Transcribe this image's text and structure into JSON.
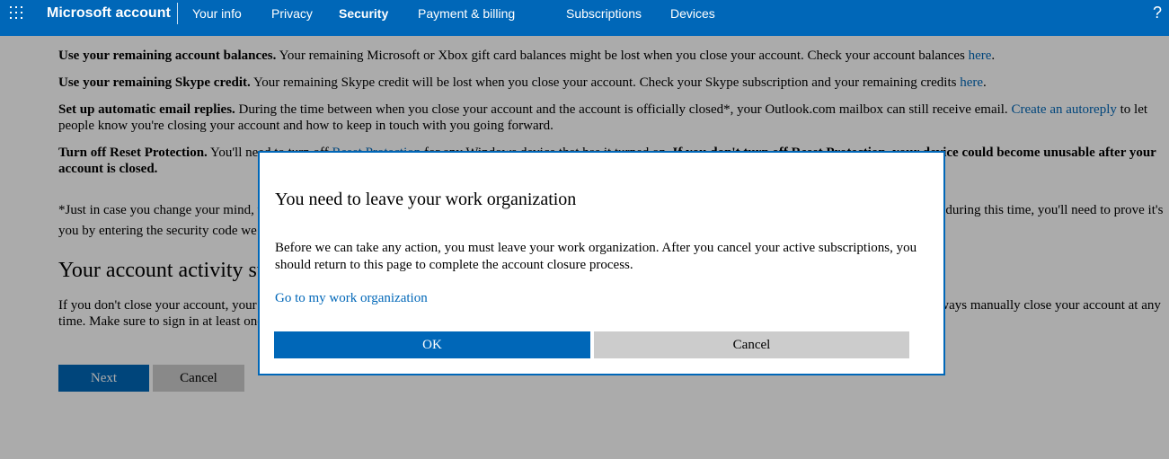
{
  "topbar": {
    "brand": "Microsoft account",
    "nav": [
      "Your info",
      "Privacy",
      "Security",
      "Payment & billing",
      "Subscriptions",
      "Devices"
    ],
    "active_tab": "Security",
    "help": "?"
  },
  "content": {
    "p1": {
      "bold": "Use your remaining account balances.",
      "text": " Your remaining Microsoft or Xbox gift card balances might be lost when you close your account. Check your account balances ",
      "link": "here",
      "end": "."
    },
    "p2": {
      "bold": "Use your remaining Skype credit.",
      "text": " Your remaining Skype credit will be lost when you close your account. Check your Skype subscription and your remaining credits ",
      "link": "here",
      "end": "."
    },
    "p3": {
      "bold": "Set up automatic email replies.",
      "text": " During the time between when you close your account and the account is officially closed*, your Outlook.com mailbox can still receive email. ",
      "link": "Create an autoreply",
      "end": " to let people know you're closing your account and how to keep in touch with you going forward."
    },
    "p4": {
      "bold": "Turn off Reset Protection.",
      "text": " You'll need to turn off ",
      "link": "Reset Protection",
      "mid": " for any Windows device that has it turned on. ",
      "bold2": "If you don't turn off Reset Protection, your device could become unusable after your account is closed."
    },
    "p5": "*Just in case you change your mind, we'll wait 60 days before permanently closing your account. During this time, your account still exists. To reopen your account during this time, you'll need to prove it's you by entering the security code we send.",
    "heading": "Your account activity status",
    "p6": "If you don't close your account, your account might still be closed if there is no activity on it, however. Your account will not be closed due to inactivity. You can always manually close your account at any time. Make sure to sign in at least once every two years to keep your account status.",
    "next_label": "Next",
    "cancel_label": "Cancel"
  },
  "dialog": {
    "title": "You need to leave your work organization",
    "body": "Before we can take any action, you must leave your work organization. After you cancel your active subscriptions, you should return to this page to complete the account closure process.",
    "link": "Go to my work organization",
    "ok_label": "OK",
    "cancel_label": "Cancel"
  },
  "colors": {
    "accent": "#0067b8",
    "secondary_button": "#cccccc"
  }
}
